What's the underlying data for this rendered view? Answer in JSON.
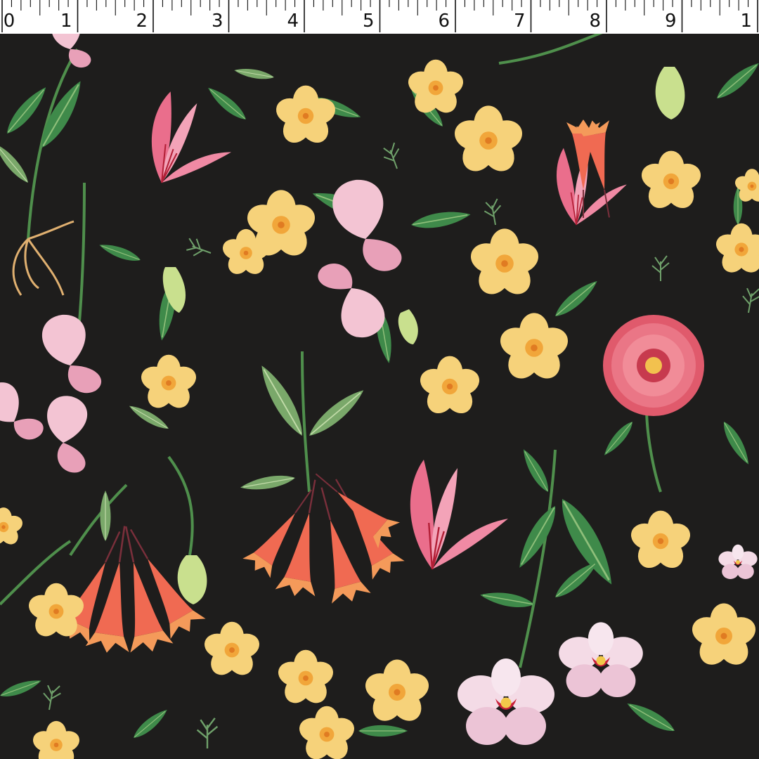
{
  "ruler": {
    "unit": "inch",
    "labels": [
      "0",
      "1",
      "2",
      "3",
      "4",
      "5",
      "6",
      "7",
      "8",
      "9",
      "1"
    ]
  },
  "fabric": {
    "background_color": "#1e1d1c",
    "motifs": [
      "yellow-blossom",
      "pink-lily",
      "sweet-pea",
      "orchid",
      "fuchsia-bell",
      "zinnia",
      "green-leaf",
      "fern-sprig"
    ],
    "palette": {
      "yellow": "#f6d27a",
      "yellow_center": "#f1a63a",
      "pink": "#ea6e8c",
      "coral": "#f06a52",
      "orchid_white": "#f4dbe6",
      "leaf": "#3f8a4a",
      "leaf_light": "#8fbf7a"
    }
  }
}
